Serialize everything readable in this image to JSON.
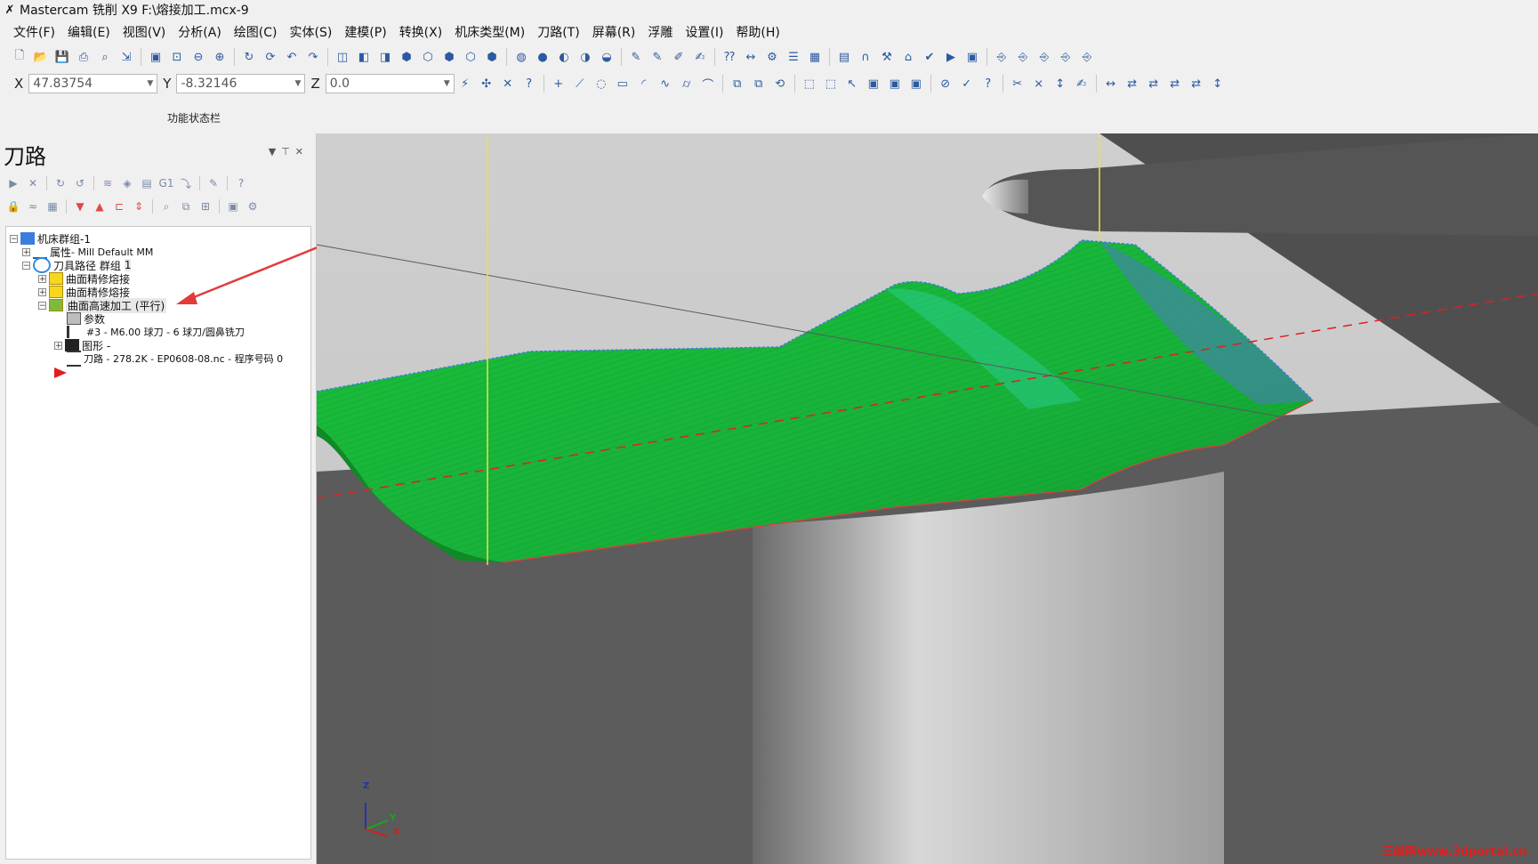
{
  "window": {
    "title": "Mastercam 铣削 X9  F:\\熔接加工.mcx-9",
    "app_icon": "mastercam-icon"
  },
  "menu": {
    "items": [
      "文件(F)",
      "编辑(E)",
      "视图(V)",
      "分析(A)",
      "绘图(C)",
      "实体(S)",
      "建模(P)",
      "转换(X)",
      "机床类型(M)",
      "刀路(T)",
      "屏幕(R)",
      "浮雕",
      "设置(I)",
      "帮助(H)"
    ]
  },
  "coords": {
    "x_label": "X",
    "x_value": "47.83754",
    "y_label": "Y",
    "y_value": "-8.32146",
    "z_label": "Z",
    "z_value": "0.0"
  },
  "status_bar_label": "功能状态栏",
  "panel": {
    "title": "刀路",
    "tree": {
      "root": "机床群组-1",
      "properties": {
        "label": "属性",
        "value": " - Mill Default MM"
      },
      "group": {
        "label": "刀具路径 群组",
        "index": "1"
      },
      "op1": "曲面精修熔接",
      "op2": "曲面精修熔接",
      "op3": "曲面高速加工 (平行)",
      "op3_children": {
        "params": "参数",
        "tool": "#3 - M6.00 球刀 - 6 球刀/圆鼻铣刀",
        "geometry": "图形 -",
        "toolpath": "刀路 - 278.2K - EP0608-08.nc - 程序号码 0"
      }
    }
  },
  "viewport": {
    "axes": {
      "z": "Z",
      "y": "Y",
      "x": "X"
    },
    "watermark": "三维网www.3dportal.cn"
  },
  "colors": {
    "toolpath_green": "#17b83c",
    "part_dark": "#5a5a5a",
    "background": "#c9c9c9",
    "axis_yellow": "#e9e24a",
    "centerline_red": "#e02020"
  }
}
